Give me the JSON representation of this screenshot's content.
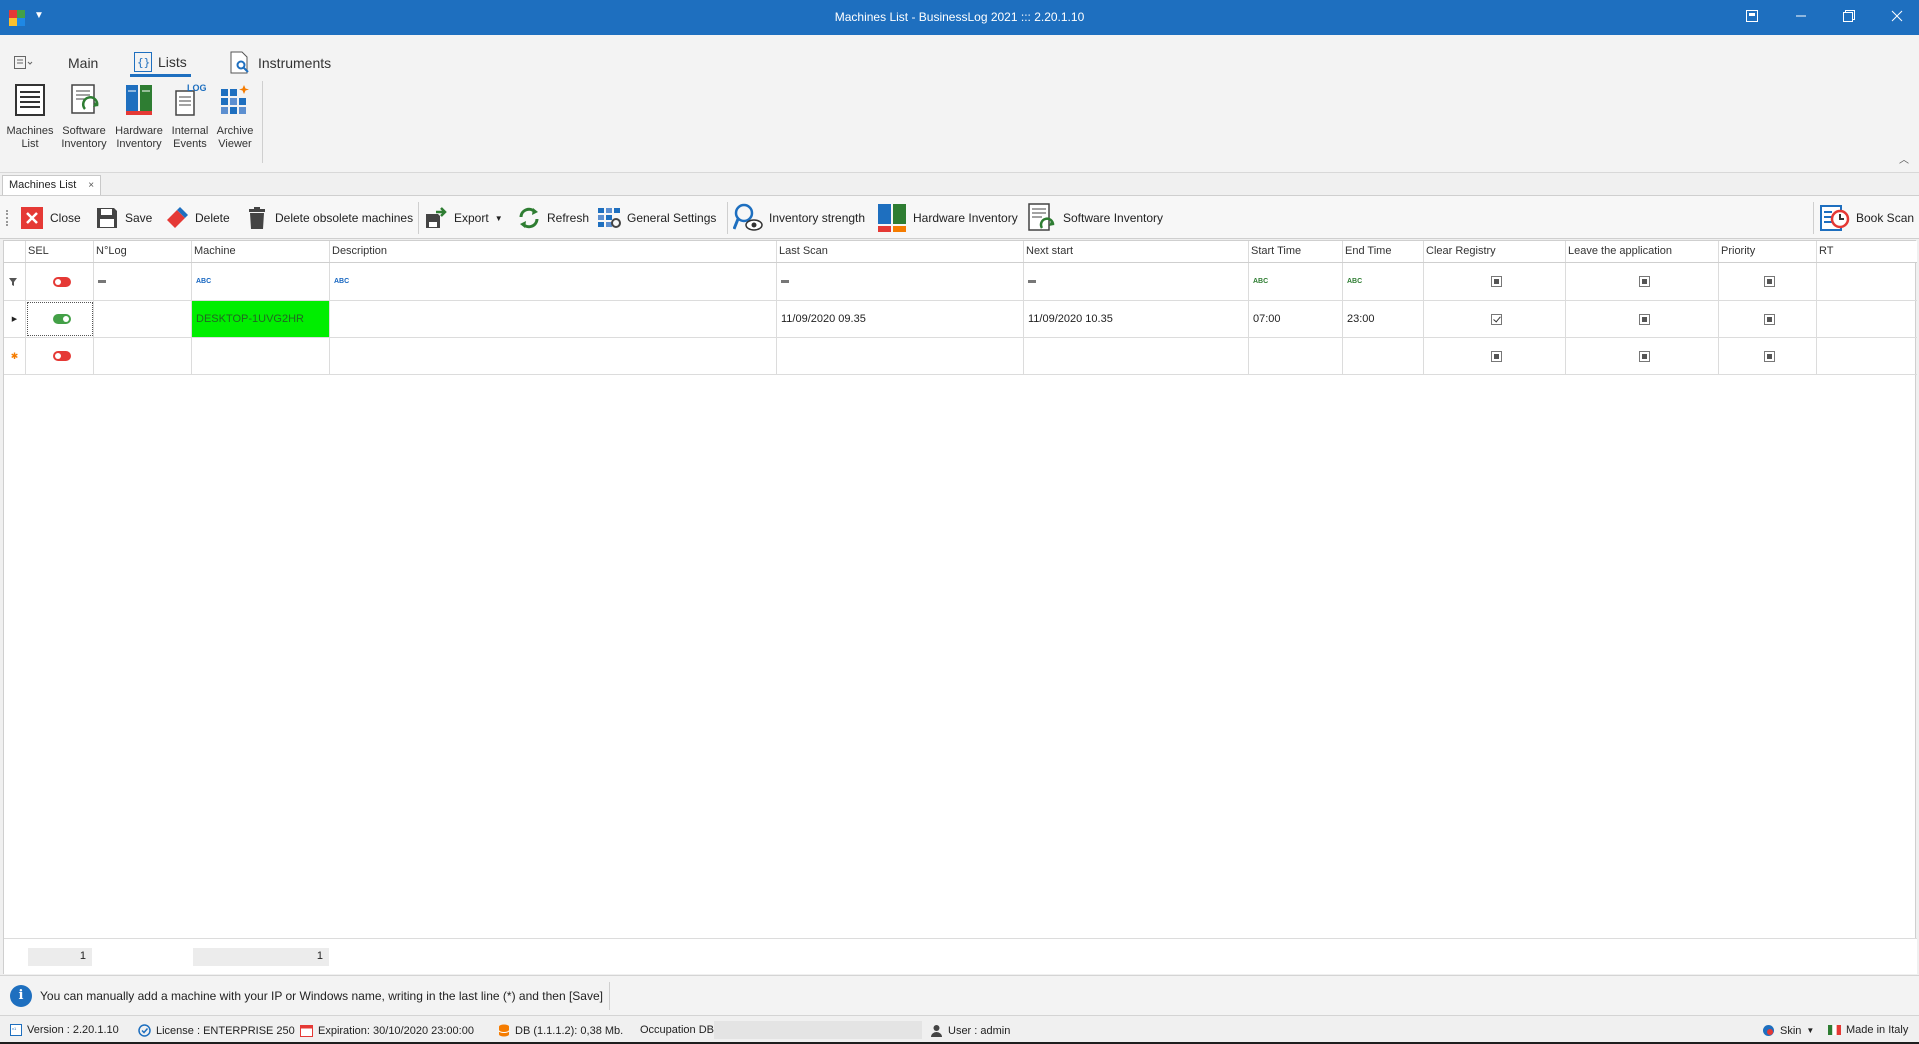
{
  "window": {
    "title": "Machines List - BusinessLog 2021 ::: 2.20.1.10",
    "controls": [
      "restore-panel",
      "minimize",
      "maximize",
      "close"
    ]
  },
  "ribbon": {
    "tabs": [
      {
        "label": "Main"
      },
      {
        "label": "Lists"
      },
      {
        "label": "Instruments"
      }
    ],
    "buttons": [
      {
        "label1": "Machines",
        "label2": "List"
      },
      {
        "label1": "Software",
        "label2": "Inventory"
      },
      {
        "label1": "Hardware",
        "label2": "Inventory"
      },
      {
        "label1": "Internal",
        "label2": "Events"
      },
      {
        "label1": "Archive",
        "label2": "Viewer"
      }
    ],
    "log_badge": "LOG"
  },
  "doc_tab": {
    "label": "Machines List",
    "close": "×"
  },
  "toolbar": {
    "close": "Close",
    "save": "Save",
    "delete": "Delete",
    "delete_obsolete": "Delete obsolete machines",
    "export": "Export",
    "refresh": "Refresh",
    "general_settings": "General Settings",
    "inventory_strength": "Inventory strength",
    "hardware_inventory": "Hardware Inventory",
    "software_inventory": "Software Inventory",
    "book_scan": "Book Scan"
  },
  "grid": {
    "columns": [
      "SEL",
      "N°Log",
      "Machine",
      "Description",
      "Last Scan",
      "Next start",
      "Start Time",
      "End Time",
      "Clear Registry",
      "Leave the application",
      "Priority",
      "RT"
    ],
    "filter_text_glyph": "ABC",
    "rows": [
      {
        "sel": "on",
        "nlog": "",
        "machine": "DESKTOP-1UVG2HR",
        "description": "",
        "last_scan": "11/09/2020 09.35",
        "next_start": "11/09/2020 10.35",
        "start_time": "07:00",
        "end_time": "23:00",
        "clear_registry": "checked",
        "leave_application": "indeterminate",
        "priority": "indeterminate",
        "rt": ""
      }
    ],
    "new_row_marker": "✱",
    "summary": {
      "nlog_count": "1",
      "machine_count": "1"
    },
    "highlight_color": "#00ee00"
  },
  "info": {
    "text": "You can manually add a machine with your IP or Windows name, writing in the last line (*) and then [Save]"
  },
  "status": {
    "version": "Version : 2.20.1.10",
    "license": "License : ENTERPRISE 250",
    "expiration": "Expiration: 30/10/2020 23:00:00",
    "db": "DB (1.1.1.2): 0,38 Mb.",
    "occupation_label": "Occupation DB",
    "occupation_fill": 0,
    "user": "User : admin",
    "skin": "Skin",
    "made_in": "Made in Italy"
  }
}
